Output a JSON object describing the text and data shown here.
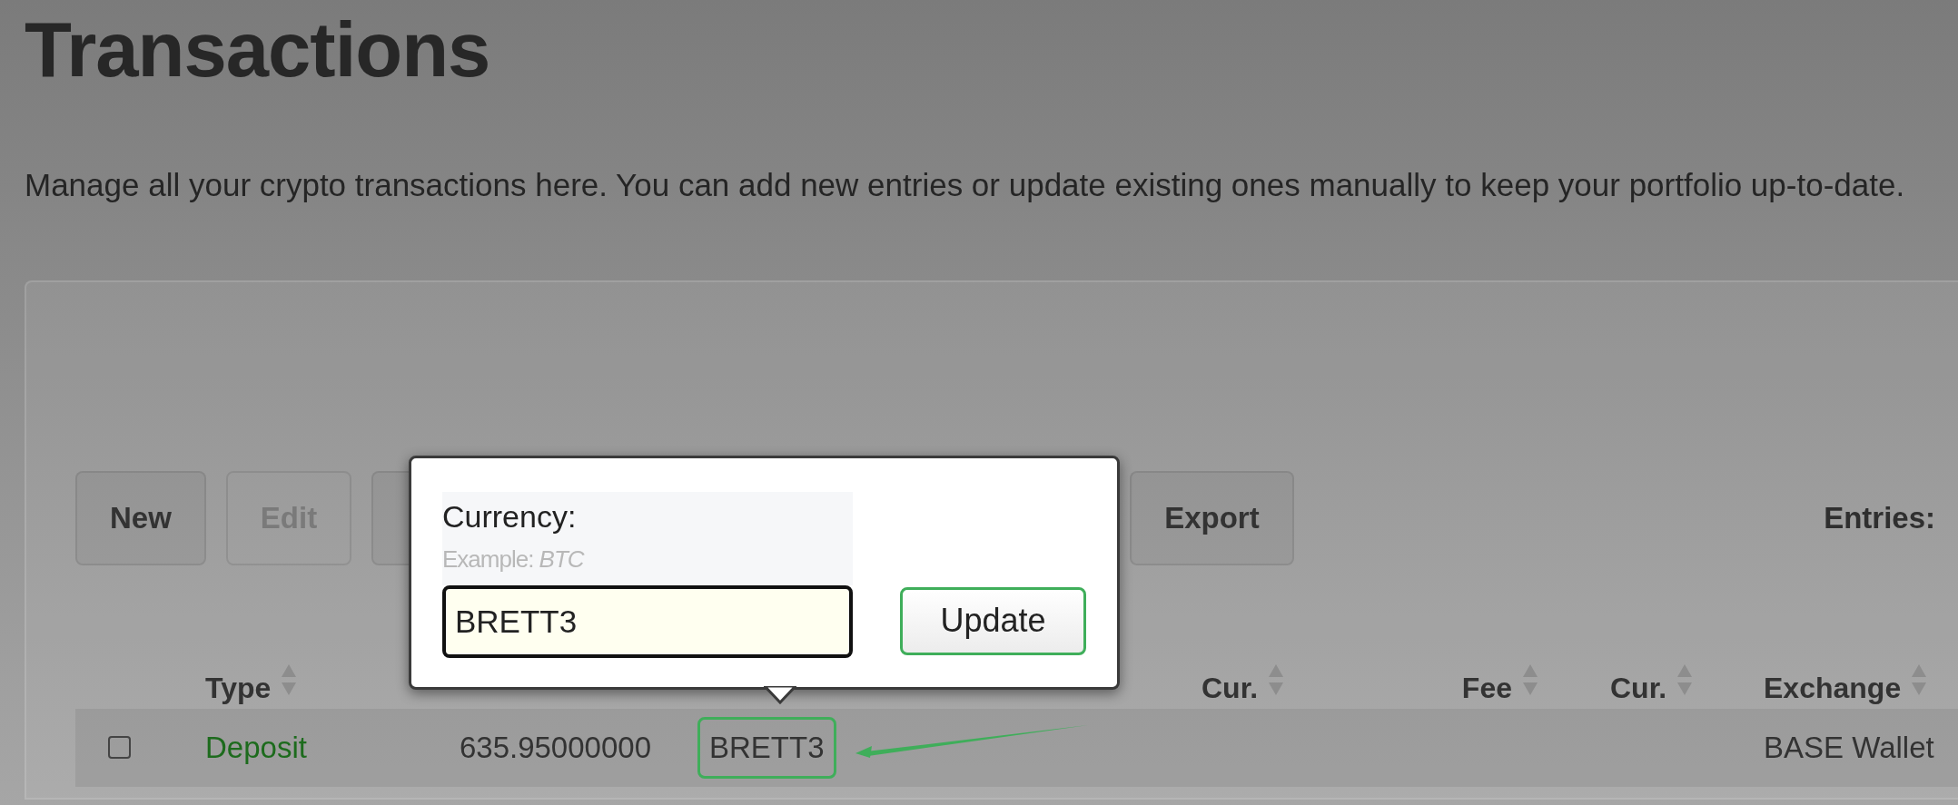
{
  "page": {
    "title": "Transactions",
    "description": "Manage all your crypto transactions here. You can add new entries or update existing ones manually to keep your portfolio up-to-date."
  },
  "toolbar": {
    "buttons": [
      {
        "kind": "button",
        "label": "New",
        "disabled": false
      },
      {
        "kind": "button",
        "label": "Edit",
        "disabled": true
      },
      {
        "kind": "covered"
      },
      {
        "kind": "button",
        "label": "Export",
        "disabled": false
      }
    ],
    "entries_label": "Entries:"
  },
  "table": {
    "columns": [
      {
        "kind": "check"
      },
      {
        "kind": "text",
        "label": "Type",
        "sortable": true
      },
      {
        "kind": "covered"
      },
      {
        "kind": "covered"
      },
      {
        "kind": "covered"
      },
      {
        "kind": "text",
        "label": "Cur.",
        "sortable": true
      },
      {
        "kind": "text",
        "label": "Fee",
        "sortable": true
      },
      {
        "kind": "text",
        "label": "Cur.",
        "sortable": true
      },
      {
        "kind": "text",
        "label": "Exchange",
        "sortable": true
      }
    ],
    "rows": [
      {
        "checked": false,
        "type": "Deposit",
        "buy": "635.95000000",
        "buy_currency": "BRETT3",
        "highlighted_cell": true,
        "exchange": "BASE Wallet"
      }
    ]
  },
  "editor_popup": {
    "label": "Currency:",
    "hint": "Example: *BTC*",
    "value": "BRETT3",
    "button": "Update"
  }
}
